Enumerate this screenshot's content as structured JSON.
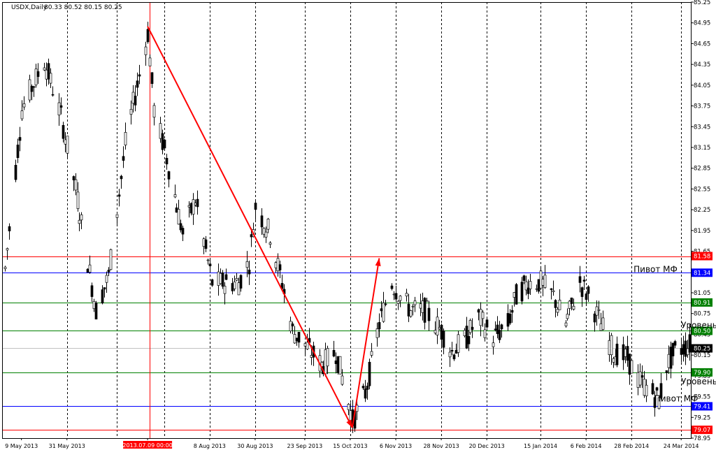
{
  "header": {
    "symbol": "USDX,Daily",
    "ohlc": "80.33 80.52 80.15 80.25"
  },
  "chart_data": {
    "type": "candlestick",
    "timeframe": "Daily",
    "grid": true,
    "y_ticks": [
      "85.25",
      "84.95",
      "84.65",
      "84.35",
      "84.05",
      "83.75",
      "83.45",
      "83.15",
      "82.85",
      "82.55",
      "82.25",
      "81.95",
      "81.65",
      "81.35",
      "81.05",
      "80.75",
      "80.45",
      "80.15",
      "79.85",
      "79.55",
      "79.25",
      "78.95"
    ],
    "x_labels": [
      "9 May 2013",
      "31 May 2013",
      "2013.07.09 00:00",
      "8 Aug 2013",
      "30 Aug 2013",
      "23 Sep 2013",
      "15 Oct 2013",
      "6 Nov 2013",
      "28 Nov 2013",
      "20 Dec 2013",
      "15 Jan 2014",
      "6 Feb 2014",
      "28 Feb 2014",
      "24 Mar 2014"
    ],
    "current_price": "80.25",
    "horizontal_levels": [
      {
        "value": "81.58",
        "color": "#ff0000"
      },
      {
        "value": "81.34",
        "color": "#0000ff"
      },
      {
        "value": "80.91",
        "color": "#008000"
      },
      {
        "value": "80.50",
        "color": "#008000"
      },
      {
        "value": "79.90",
        "color": "#008000"
      },
      {
        "value": "79.41",
        "color": "#0000ff"
      },
      {
        "value": "79.07",
        "color": "#ff0000"
      }
    ],
    "annotations": [
      "Пивот МФ",
      "Уровень сопротивления",
      "Уровень поддержки",
      "Пивот МФ"
    ],
    "trend_lines": [
      {
        "from": [
          "2013.07.09",
          84.9
        ],
        "to": [
          "2013.10.16",
          79.1
        ],
        "color": "#ff0000"
      },
      {
        "from": [
          "2013.10.16",
          79.1
        ],
        "to": [
          "2013.10.29",
          81.55
        ],
        "color": "#ff0000",
        "arrow": true
      }
    ]
  }
}
